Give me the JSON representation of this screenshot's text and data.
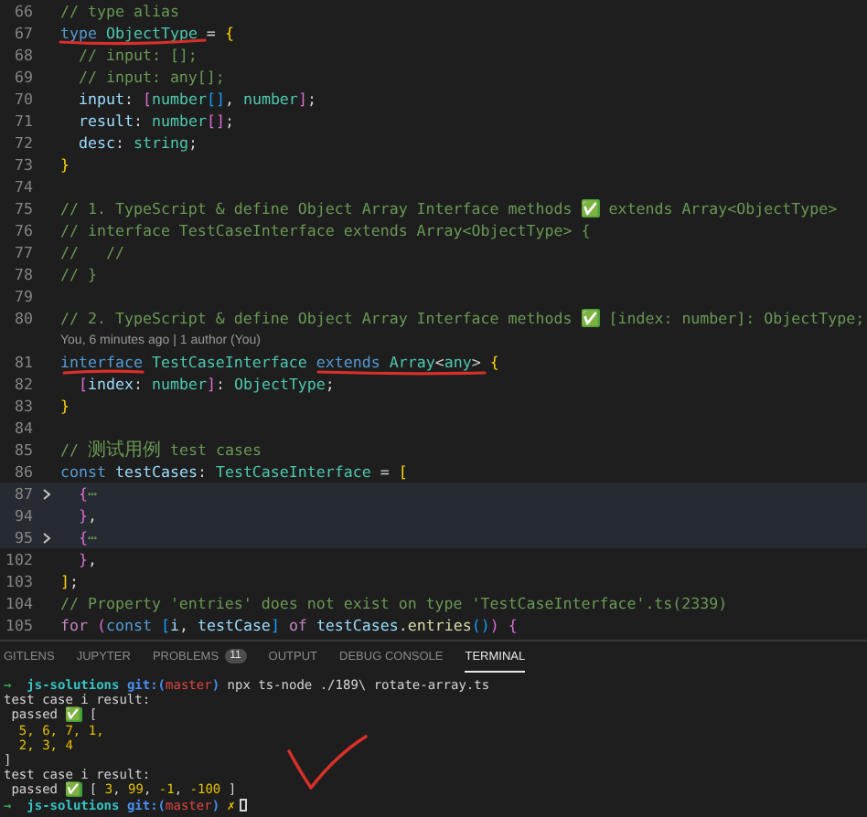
{
  "editor": {
    "lines": [
      {
        "kind": "code",
        "number": "66",
        "folded": false,
        "highlighted": false,
        "tokens": [
          {
            "kind": "comment",
            "text": "// type alias"
          }
        ]
      },
      {
        "kind": "code",
        "number": "67",
        "folded": false,
        "highlighted": false,
        "tokens": [
          {
            "kind": "keyword",
            "text": "type "
          },
          {
            "kind": "type",
            "text": "ObjectType"
          },
          {
            "kind": "plain",
            "text": " = "
          },
          {
            "kind": "brace1",
            "text": "{"
          }
        ]
      },
      {
        "kind": "code",
        "number": "68",
        "folded": false,
        "highlighted": false,
        "tokens": [
          {
            "kind": "comment",
            "text": "  // input: [];"
          }
        ]
      },
      {
        "kind": "code",
        "number": "69",
        "folded": false,
        "highlighted": false,
        "tokens": [
          {
            "kind": "comment",
            "text": "  // input: any[];"
          }
        ]
      },
      {
        "kind": "code",
        "number": "70",
        "folded": false,
        "highlighted": false,
        "tokens": [
          {
            "kind": "prop",
            "text": "  input"
          },
          {
            "kind": "plain",
            "text": ": "
          },
          {
            "kind": "brace2",
            "text": "["
          },
          {
            "kind": "type",
            "text": "number"
          },
          {
            "kind": "brace3",
            "text": "[]"
          },
          {
            "kind": "plain",
            "text": ", "
          },
          {
            "kind": "type",
            "text": "number"
          },
          {
            "kind": "brace2",
            "text": "]"
          },
          {
            "kind": "plain",
            "text": ";"
          }
        ]
      },
      {
        "kind": "code",
        "number": "71",
        "folded": false,
        "highlighted": false,
        "tokens": [
          {
            "kind": "prop",
            "text": "  result"
          },
          {
            "kind": "plain",
            "text": ": "
          },
          {
            "kind": "type",
            "text": "number"
          },
          {
            "kind": "brace2",
            "text": "[]"
          },
          {
            "kind": "plain",
            "text": ";"
          }
        ]
      },
      {
        "kind": "code",
        "number": "72",
        "folded": false,
        "highlighted": false,
        "tokens": [
          {
            "kind": "prop",
            "text": "  desc"
          },
          {
            "kind": "plain",
            "text": ": "
          },
          {
            "kind": "type",
            "text": "string"
          },
          {
            "kind": "plain",
            "text": ";"
          }
        ]
      },
      {
        "kind": "code",
        "number": "73",
        "folded": false,
        "highlighted": false,
        "tokens": [
          {
            "kind": "brace1",
            "text": "}"
          }
        ]
      },
      {
        "kind": "code",
        "number": "74",
        "folded": false,
        "highlighted": false
      },
      {
        "kind": "code",
        "number": "75",
        "folded": false,
        "highlighted": false,
        "tokens": [
          {
            "kind": "comment",
            "text": "// 1. TypeScript & define Object Array Interface methods "
          },
          {
            "kind": "check",
            "text": "✅"
          },
          {
            "kind": "comment",
            "text": " extends Array<ObjectType>"
          }
        ]
      },
      {
        "kind": "code",
        "number": "76",
        "folded": false,
        "highlighted": false,
        "tokens": [
          {
            "kind": "comment",
            "text": "// interface TestCaseInterface extends Array<ObjectType> {"
          }
        ]
      },
      {
        "kind": "code",
        "number": "77",
        "folded": false,
        "highlighted": false,
        "tokens": [
          {
            "kind": "comment",
            "text": "//   //"
          }
        ]
      },
      {
        "kind": "code",
        "number": "78",
        "folded": false,
        "highlighted": false,
        "tokens": [
          {
            "kind": "comment",
            "text": "// }"
          }
        ]
      },
      {
        "kind": "code",
        "number": "79",
        "folded": false,
        "highlighted": false
      },
      {
        "kind": "code",
        "number": "80",
        "folded": false,
        "highlighted": false,
        "tokens": [
          {
            "kind": "comment",
            "text": "// 2. TypeScript & define Object Array Interface methods "
          },
          {
            "kind": "check",
            "text": "✅"
          },
          {
            "kind": "comment",
            "text": " [index: number]: ObjectType;"
          }
        ]
      },
      {
        "kind": "codelens",
        "text": "You, 6 minutes ago | 1 author (You)"
      },
      {
        "kind": "code",
        "number": "81",
        "folded": false,
        "highlighted": false,
        "tokens": [
          {
            "kind": "keyword",
            "text": "interface "
          },
          {
            "kind": "type",
            "text": "TestCaseInterface "
          },
          {
            "kind": "keyword",
            "text": "extends "
          },
          {
            "kind": "type",
            "text": "Array"
          },
          {
            "kind": "plain",
            "text": "<"
          },
          {
            "kind": "type",
            "text": "any"
          },
          {
            "kind": "plain",
            "text": "> "
          },
          {
            "kind": "brace1",
            "text": "{"
          }
        ]
      },
      {
        "kind": "code",
        "number": "82",
        "folded": false,
        "highlighted": false,
        "tokens": [
          {
            "kind": "brace2",
            "text": "  ["
          },
          {
            "kind": "prop",
            "text": "index"
          },
          {
            "kind": "plain",
            "text": ": "
          },
          {
            "kind": "type",
            "text": "number"
          },
          {
            "kind": "brace2",
            "text": "]"
          },
          {
            "kind": "plain",
            "text": ": "
          },
          {
            "kind": "type",
            "text": "ObjectType"
          },
          {
            "kind": "plain",
            "text": ";"
          }
        ]
      },
      {
        "kind": "code",
        "number": "83",
        "folded": false,
        "highlighted": false,
        "tokens": [
          {
            "kind": "brace1",
            "text": "}"
          }
        ]
      },
      {
        "kind": "code",
        "number": "84",
        "folded": false,
        "highlighted": false
      },
      {
        "kind": "code",
        "number": "85",
        "folded": false,
        "highlighted": false,
        "tokens": [
          {
            "kind": "comment",
            "text": "// "
          },
          {
            "kind": "cjk",
            "text": "测试用例"
          },
          {
            "kind": "comment",
            "text": " test cases"
          }
        ]
      },
      {
        "kind": "code",
        "number": "86",
        "folded": false,
        "highlighted": false,
        "tokens": [
          {
            "kind": "keyword",
            "text": "const "
          },
          {
            "kind": "var",
            "text": "testCases"
          },
          {
            "kind": "plain",
            "text": ": "
          },
          {
            "kind": "type",
            "text": "TestCaseInterface"
          },
          {
            "kind": "plain",
            "text": " = "
          },
          {
            "kind": "brace1",
            "text": "["
          }
        ]
      },
      {
        "kind": "code",
        "number": "87",
        "folded": true,
        "highlighted": true,
        "tokens": [
          {
            "kind": "brace2",
            "text": "  {"
          },
          {
            "kind": "comment",
            "text": "⋯"
          }
        ]
      },
      {
        "kind": "code",
        "number": "94",
        "folded": false,
        "highlighted": true,
        "tokens": [
          {
            "kind": "brace2",
            "text": "  }"
          },
          {
            "kind": "plain",
            "text": ","
          }
        ]
      },
      {
        "kind": "code",
        "number": "95",
        "folded": true,
        "highlighted": true,
        "tokens": [
          {
            "kind": "brace2",
            "text": "  {"
          },
          {
            "kind": "comment",
            "text": "⋯"
          }
        ]
      },
      {
        "kind": "code",
        "number": "102",
        "folded": false,
        "highlighted": false,
        "tokens": [
          {
            "kind": "brace2",
            "text": "  }"
          },
          {
            "kind": "plain",
            "text": ","
          }
        ]
      },
      {
        "kind": "code",
        "number": "103",
        "folded": false,
        "highlighted": false,
        "tokens": [
          {
            "kind": "brace1",
            "text": "]"
          },
          {
            "kind": "plain",
            "text": ";"
          }
        ]
      },
      {
        "kind": "code",
        "number": "104",
        "folded": false,
        "highlighted": false,
        "tokens": [
          {
            "kind": "comment",
            "text": "// Property 'entries' does not exist on type 'TestCaseInterface'.ts(2339)"
          }
        ]
      },
      {
        "kind": "code",
        "number": "105",
        "folded": false,
        "highlighted": false,
        "tokens": [
          {
            "kind": "control",
            "text": "for "
          },
          {
            "kind": "brace2",
            "text": "("
          },
          {
            "kind": "keyword",
            "text": "const "
          },
          {
            "kind": "brace3",
            "text": "["
          },
          {
            "kind": "var",
            "text": "i"
          },
          {
            "kind": "plain",
            "text": ", "
          },
          {
            "kind": "var",
            "text": "testCase"
          },
          {
            "kind": "brace3",
            "text": "] "
          },
          {
            "kind": "control",
            "text": "of "
          },
          {
            "kind": "var",
            "text": "testCases"
          },
          {
            "kind": "plain",
            "text": "."
          },
          {
            "kind": "func",
            "text": "entries"
          },
          {
            "kind": "brace3",
            "text": "()"
          },
          {
            "kind": "brace2",
            "text": ") {"
          }
        ]
      }
    ]
  },
  "panel": {
    "tabs": [
      {
        "label": "GITLENS",
        "selected": false
      },
      {
        "label": "JUPYTER",
        "selected": false
      },
      {
        "label": "PROBLEMS",
        "selected": false,
        "badge": "11"
      },
      {
        "label": "OUTPUT",
        "selected": false
      },
      {
        "label": "DEBUG CONSOLE",
        "selected": false
      },
      {
        "label": "TERMINAL",
        "selected": true
      }
    ],
    "terminal": {
      "cursor": true,
      "lines": [
        [
          {
            "kind": "arrow",
            "text": "→  "
          },
          {
            "kind": "dir",
            "text": "js-solutions "
          },
          {
            "kind": "git",
            "text": "git:("
          },
          {
            "kind": "branch",
            "text": "master"
          },
          {
            "kind": "git",
            "text": ")"
          },
          {
            "kind": "plain",
            "text": " npx ts-node ./189\\ rotate-array.ts"
          }
        ],
        [
          {
            "kind": "plain",
            "text": "test case i result:"
          }
        ],
        [
          {
            "kind": "plain",
            "text": " passed "
          },
          {
            "kind": "check",
            "text": "✅"
          },
          {
            "kind": "plain",
            "text": " ["
          }
        ],
        [
          {
            "kind": "num",
            "text": "  5, 6, 7, 1,"
          }
        ],
        [
          {
            "kind": "num",
            "text": "  2, 3, 4"
          }
        ],
        [
          {
            "kind": "plain",
            "text": "]"
          }
        ],
        [
          {
            "kind": "plain",
            "text": "test case i result:"
          }
        ],
        [
          {
            "kind": "plain",
            "text": " passed "
          },
          {
            "kind": "check",
            "text": "✅"
          },
          {
            "kind": "plain",
            "text": " [ "
          },
          {
            "kind": "num",
            "text": "3"
          },
          {
            "kind": "plain",
            "text": ", "
          },
          {
            "kind": "num",
            "text": "99"
          },
          {
            "kind": "plain",
            "text": ", "
          },
          {
            "kind": "num",
            "text": "-1"
          },
          {
            "kind": "plain",
            "text": ", "
          },
          {
            "kind": "num",
            "text": "-100"
          },
          {
            "kind": "plain",
            "text": " ]"
          }
        ],
        [
          {
            "kind": "arrow",
            "text": "→  "
          },
          {
            "kind": "dir",
            "text": "js-solutions "
          },
          {
            "kind": "git",
            "text": "git:("
          },
          {
            "kind": "branch",
            "text": "master"
          },
          {
            "kind": "git",
            "text": ")"
          },
          {
            "kind": "dirty",
            "text": " ✗"
          }
        ]
      ]
    }
  }
}
